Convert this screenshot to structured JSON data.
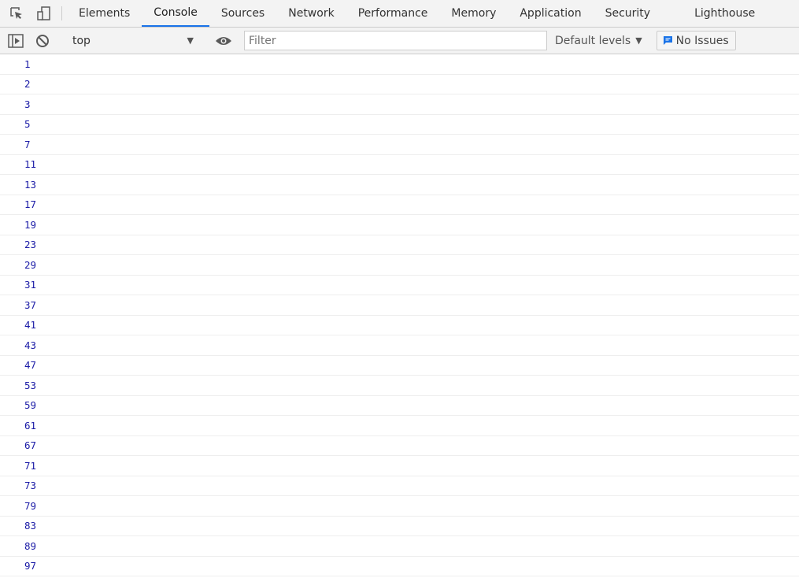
{
  "tabs": [
    "Elements",
    "Console",
    "Sources",
    "Network",
    "Performance",
    "Memory",
    "Application",
    "Security",
    "Lighthouse"
  ],
  "active_tab": "Console",
  "toolbar": {
    "context": "top",
    "filter_placeholder": "Filter",
    "levels": "Default levels",
    "issues": "No Issues"
  },
  "accent": "#1a73e8",
  "log_color": "#1a1aa6",
  "logs": [
    "1",
    "2",
    "3",
    "5",
    "7",
    "11",
    "13",
    "17",
    "19",
    "23",
    "29",
    "31",
    "37",
    "41",
    "43",
    "47",
    "53",
    "59",
    "61",
    "67",
    "71",
    "73",
    "79",
    "83",
    "89",
    "97"
  ]
}
